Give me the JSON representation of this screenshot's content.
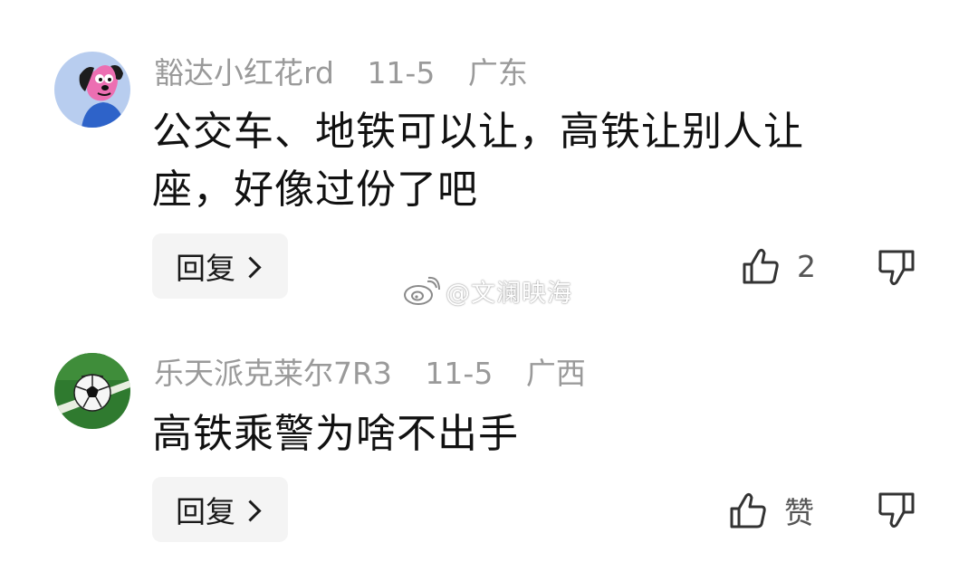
{
  "comments": [
    {
      "username": "豁达小红花rd",
      "date": "11-5",
      "location": "广东",
      "text": "公交车、地铁可以让，高铁让别人让座，好像过份了吧",
      "reply_label": "回复",
      "like_count": "2",
      "avatar_icon": "cartoon-dog-avatar"
    },
    {
      "username": "乐天派克莱尔7R3",
      "date": "11-5",
      "location": "广西",
      "text": "高铁乘警为啥不出手",
      "reply_label": "回复",
      "like_count": "赞",
      "avatar_icon": "soccer-ball-avatar"
    }
  ],
  "watermark": {
    "text": "@文澜映海",
    "icon": "weibo-logo-icon"
  },
  "colors": {
    "meta_text": "#9a9a9a",
    "reply_bg": "#f4f4f4",
    "icon_stroke": "#333333"
  }
}
